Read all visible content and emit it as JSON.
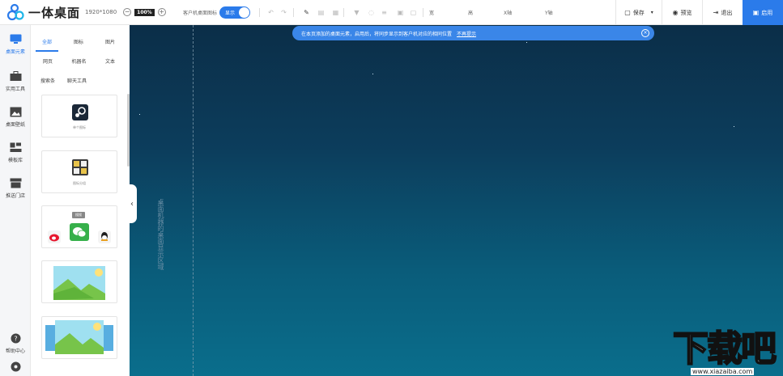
{
  "app": {
    "name": "一体桌面",
    "resolution": "1920*1080",
    "zoom": "100%"
  },
  "toolbar": {
    "client_icon_label": "客户机桌面图标",
    "toggle_label": "显示",
    "width_label": "宽",
    "height_label": "高",
    "x_label": "X轴",
    "y_label": "Y轴",
    "save_label": "保存",
    "preview_label": "预览",
    "exit_label": "退出",
    "publish_label": "启用"
  },
  "sidebar": {
    "items": [
      {
        "label": "桌面元素",
        "icon": "monitor-icon",
        "active": true
      },
      {
        "label": "实用工具",
        "icon": "toolbox-icon"
      },
      {
        "label": "桌面壁纸",
        "icon": "image-icon"
      },
      {
        "label": "模板库",
        "icon": "template-icon"
      },
      {
        "label": "推送门店",
        "icon": "store-icon"
      },
      {
        "label": "帮助中心",
        "icon": "help-icon"
      }
    ]
  },
  "panel": {
    "tabs": [
      "全部",
      "图标",
      "图片"
    ],
    "subtabs": [
      "网页",
      "机器名",
      "文本"
    ],
    "subtabs2": [
      "搜索条",
      "聊天工具"
    ],
    "cards": [
      {
        "caption": "单个图标"
      },
      {
        "caption": "图标分组"
      },
      {
        "caption": ""
      },
      {
        "caption": ""
      },
      {
        "caption": ""
      }
    ],
    "chat_bubble": "搜搜"
  },
  "canvas": {
    "notice_text": "在本页添加的桌面元素，启用后，将同步显示到客户机对应的相同位置",
    "notice_link": "不再提示",
    "vertical_label": "桌面机器的桌面显示区域"
  },
  "watermark": {
    "main": "下载吧",
    "url": "www.xiazaiba.com"
  },
  "colors": {
    "accent": "#2b7bea",
    "canvas_top": "#0b2e48",
    "canvas_bottom": "#0a6e8c"
  }
}
